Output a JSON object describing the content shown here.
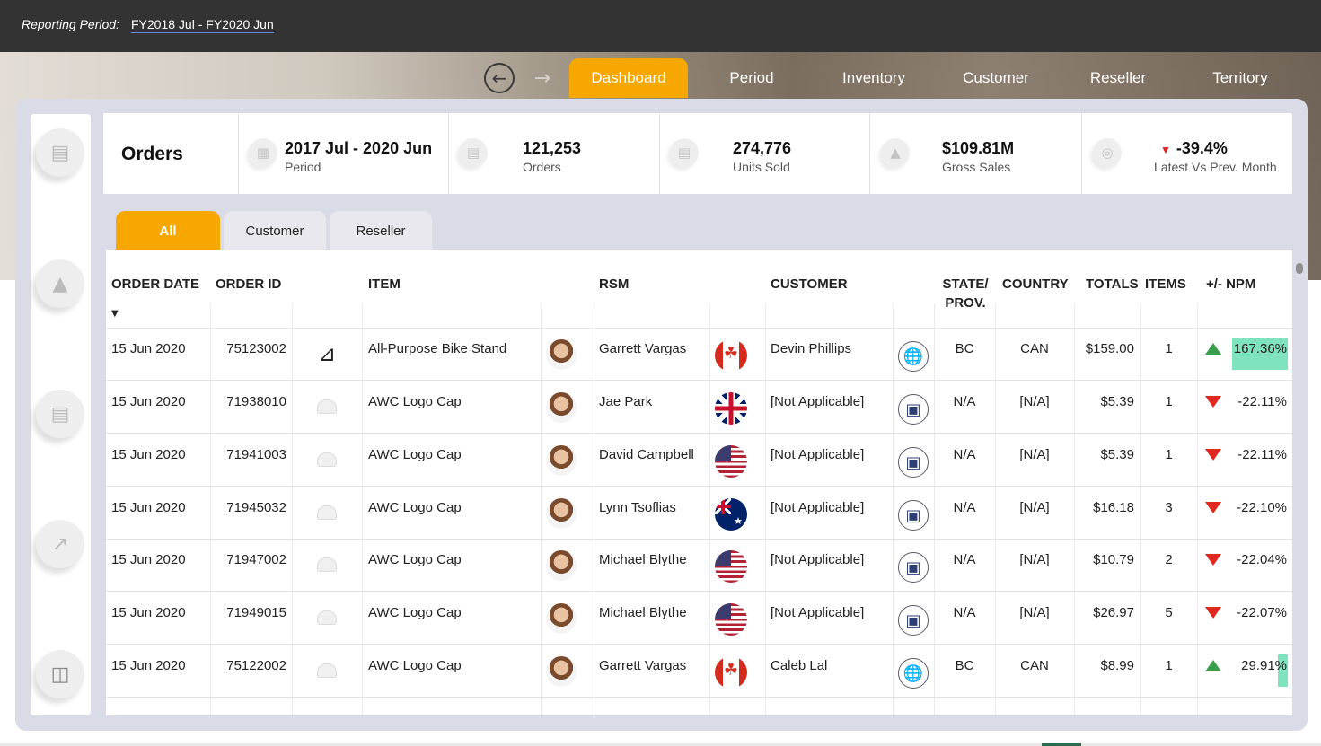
{
  "header": {
    "reporting_period_label": "Reporting Period:",
    "reporting_period_value": "FY2018  Jul - FY2020  Jun"
  },
  "nav": {
    "back_icon": "back-arrow-icon",
    "forward_icon": "forward-arrow-icon",
    "tabs": [
      {
        "label": "Dashboard",
        "active": true
      },
      {
        "label": "Period",
        "active": false
      },
      {
        "label": "Inventory",
        "active": false
      },
      {
        "label": "Customer",
        "active": false
      },
      {
        "label": "Reseller",
        "active": false
      },
      {
        "label": "Territory",
        "active": false
      }
    ]
  },
  "sidebar": {
    "icons": [
      "orders-icon",
      "sales-icon",
      "money-icon",
      "growth-chart-icon",
      "database-icon"
    ]
  },
  "kpis": {
    "title": "Orders",
    "items": [
      {
        "value": "2017 Jul - 2020 Jun",
        "label": "Period",
        "icon": "calendar-icon"
      },
      {
        "value": "121,253",
        "label": "Orders",
        "icon": "orders-icon"
      },
      {
        "value": "274,776",
        "label": "Units Sold",
        "icon": "units-icon"
      },
      {
        "value": "$109.81M",
        "label": "Gross Sales",
        "icon": "sales-icon"
      },
      {
        "value": "-39.4%",
        "label": "Latest Vs Prev. Month",
        "icon": "target-icon",
        "trend": "down"
      }
    ]
  },
  "subtabs": [
    {
      "label": "All",
      "active": true
    },
    {
      "label": "Customer",
      "active": false
    },
    {
      "label": "Reseller",
      "active": false
    }
  ],
  "table": {
    "headers": {
      "order_date": "ORDER DATE",
      "order_id": "ORDER ID",
      "item": "ITEM",
      "rsm": "RSM",
      "customer": "CUSTOMER",
      "state_line1": "STATE/",
      "state_line2": "PROV.",
      "country": "COUNTRY",
      "totals": "TOTALS",
      "items": "ITEMS",
      "npm": "+/- NPM"
    },
    "sort": "descending",
    "rows": [
      {
        "date": "15 Jun 2020",
        "id": "75123002",
        "item": "All-Purpose Bike Stand",
        "item_icon": "bike-stand-icon",
        "rsm": "Garrett Vargas",
        "flag": "can",
        "customer": "Devin Phillips",
        "customer_type": "globe-icon",
        "state": "BC",
        "country": "CAN",
        "total": "$159.00",
        "items": "1",
        "trend": "up",
        "npm": "167.36%",
        "npm_value": 167.36
      },
      {
        "date": "15 Jun 2020",
        "id": "71938010",
        "item": "AWC Logo Cap",
        "item_icon": "cap-icon",
        "rsm": "Jae Park",
        "flag": "gbr",
        "customer": "[Not Applicable]",
        "customer_type": "store-icon",
        "state": "N/A",
        "country": "[N/A]",
        "total": "$5.39",
        "items": "1",
        "trend": "down",
        "npm": "-22.11%",
        "npm_value": -22.11
      },
      {
        "date": "15 Jun 2020",
        "id": "71941003",
        "item": "AWC Logo Cap",
        "item_icon": "cap-icon",
        "rsm": "David Campbell",
        "flag": "usa",
        "customer": "[Not Applicable]",
        "customer_type": "store-icon",
        "state": "N/A",
        "country": "[N/A]",
        "total": "$5.39",
        "items": "1",
        "trend": "down",
        "npm": "-22.11%",
        "npm_value": -22.11
      },
      {
        "date": "15 Jun 2020",
        "id": "71945032",
        "item": "AWC Logo Cap",
        "item_icon": "cap-icon",
        "rsm": "Lynn Tsoflias",
        "flag": "aus",
        "customer": "[Not Applicable]",
        "customer_type": "store-icon",
        "state": "N/A",
        "country": "[N/A]",
        "total": "$16.18",
        "items": "3",
        "trend": "down",
        "npm": "-22.10%",
        "npm_value": -22.1
      },
      {
        "date": "15 Jun 2020",
        "id": "71947002",
        "item": "AWC Logo Cap",
        "item_icon": "cap-icon",
        "rsm": "Michael Blythe",
        "flag": "usa",
        "customer": "[Not Applicable]",
        "customer_type": "store-icon",
        "state": "N/A",
        "country": "[N/A]",
        "total": "$10.79",
        "items": "2",
        "trend": "down",
        "npm": "-22.04%",
        "npm_value": -22.04
      },
      {
        "date": "15 Jun 2020",
        "id": "71949015",
        "item": "AWC Logo Cap",
        "item_icon": "cap-icon",
        "rsm": "Michael Blythe",
        "flag": "usa",
        "customer": "[Not Applicable]",
        "customer_type": "store-icon",
        "state": "N/A",
        "country": "[N/A]",
        "total": "$26.97",
        "items": "5",
        "trend": "down",
        "npm": "-22.07%",
        "npm_value": -22.07
      },
      {
        "date": "15 Jun 2020",
        "id": "75122002",
        "item": "AWC Logo Cap",
        "item_icon": "cap-icon",
        "rsm": "Garrett Vargas",
        "flag": "can",
        "customer": "Caleb Lal",
        "customer_type": "globe-icon",
        "state": "BC",
        "country": "CAN",
        "total": "$8.99",
        "items": "1",
        "trend": "up",
        "npm": "29.91%",
        "npm_value": 29.91
      }
    ]
  },
  "colors": {
    "accent": "#f7a800",
    "topbar": "#333333",
    "panel": "#d9dbe6",
    "npm_positive_bar": "#7fe3bd",
    "trend_up": "#3a9d4c",
    "trend_down": "#e0281e"
  }
}
